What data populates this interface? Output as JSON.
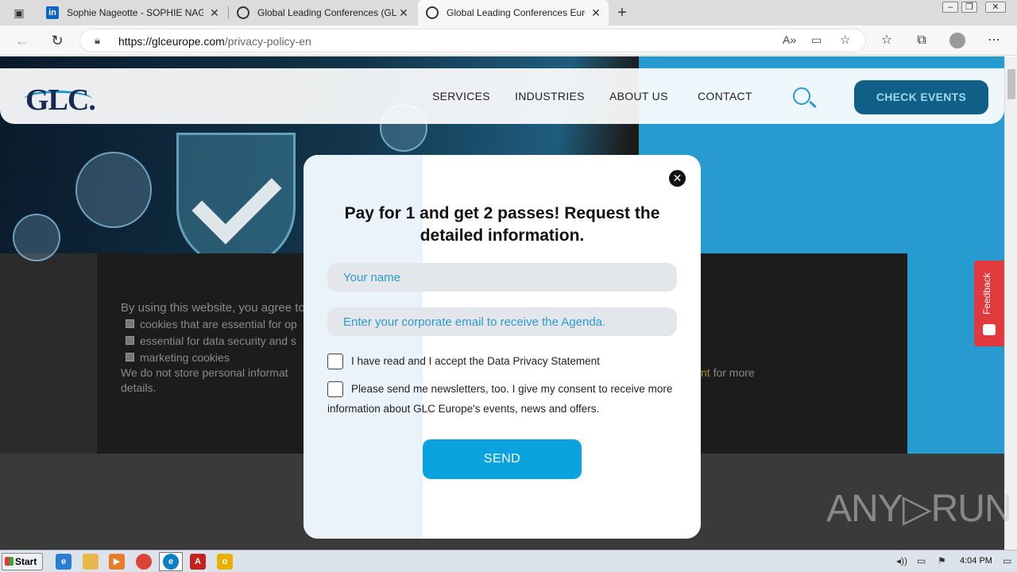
{
  "browser": {
    "tabs": [
      {
        "title": "Sophie Nageotte - SOPHIE NAGE",
        "icon": "linkedin-icon"
      },
      {
        "title": "Global Leading Conferences (GLC",
        "icon": "glc-icon"
      },
      {
        "title": "Global Leading Conferences Euro",
        "icon": "glc-icon"
      }
    ],
    "url_host": "https://glceurope.com",
    "url_path": "/privacy-policy-en"
  },
  "site": {
    "logo": "GLC.",
    "nav": [
      "SERVICES",
      "INDUSTRIES",
      "ABOUT US",
      "CONTACT"
    ],
    "cta": "CHECK EVENTS",
    "feedback": "Feedback"
  },
  "cookie": {
    "intro": "By using this website, you agree to",
    "options": [
      "cookies that are essential for op",
      "essential for data security and s",
      "marketing cookies"
    ],
    "note": "We do not store personal informat",
    "note_link": "nt",
    "note_tail": "for more",
    "details": "details."
  },
  "modal": {
    "title": "Pay for 1 and get 2 passes! Request the detailed information.",
    "name_placeholder": "Your name",
    "email_placeholder": "Enter your corporate email to receive the Agenda.",
    "privacy_label": "I have read and I accept the Data Privacy Statement",
    "newsletter_label": "Please send me newsletters, too. I give my consent to receive more information about GLC Europe's events, news and offers.",
    "send": "SEND",
    "close": "✕"
  },
  "watermark": "ANY▷RUN",
  "taskbar": {
    "start": "Start",
    "time": "4:04 PM"
  },
  "colors": {
    "accent": "#0ba2e0",
    "brand_navy": "#172a52",
    "feedback": "#e0393e"
  }
}
